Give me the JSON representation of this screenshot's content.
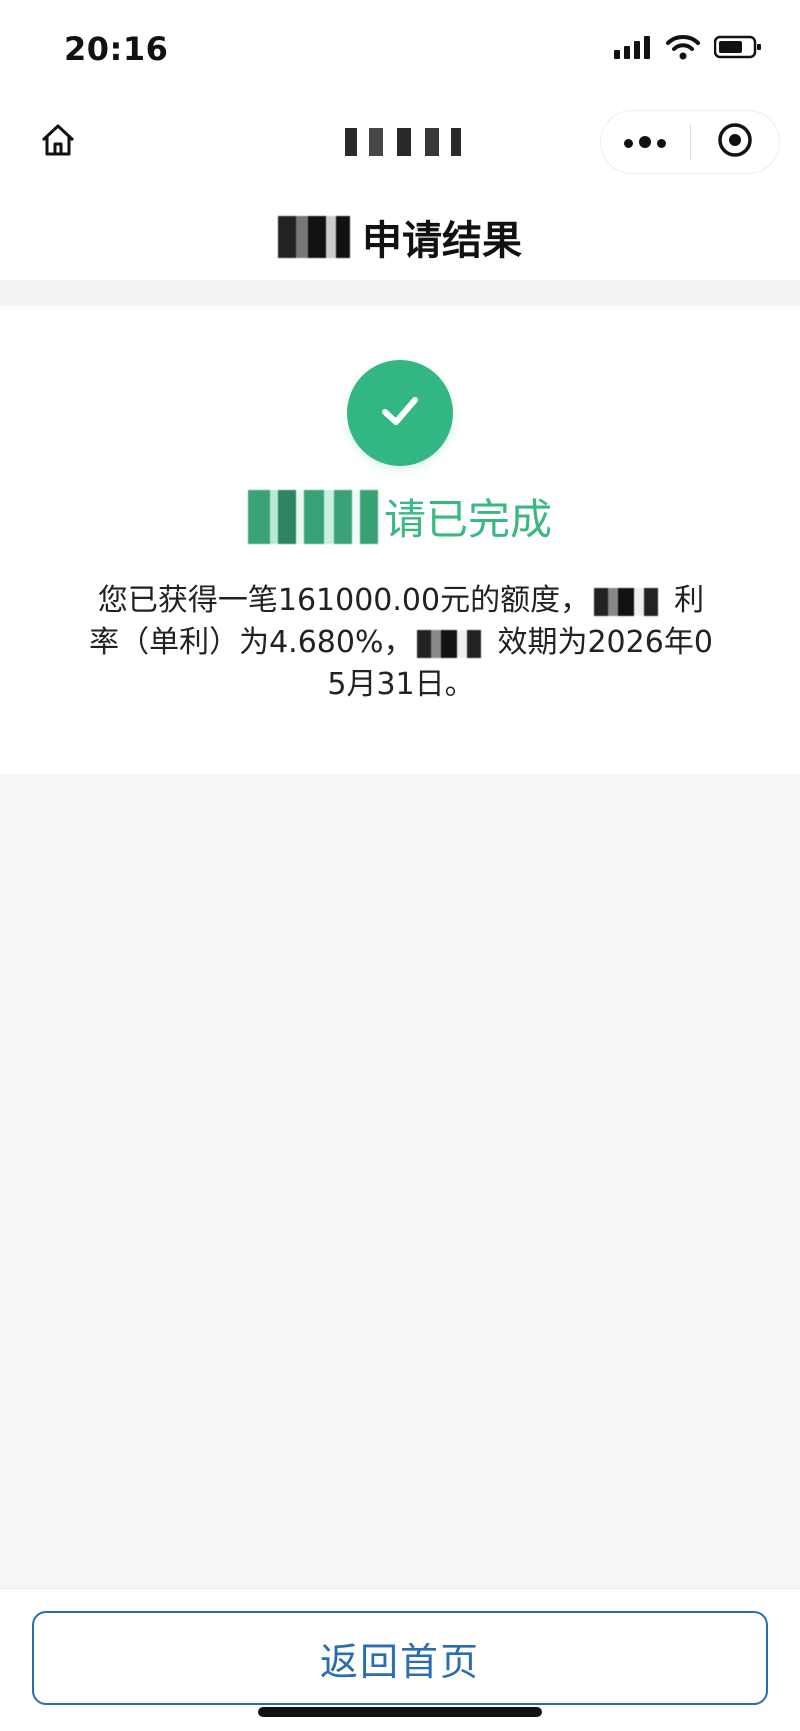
{
  "status_bar": {
    "time": "20:16"
  },
  "nav": {
    "title": ""
  },
  "page_header": {
    "title_suffix": "申请结果"
  },
  "result": {
    "title_suffix": "请已完成",
    "message_part1": "您已获得一笔161000.00元的额度，",
    "message_part2": "利率（单利）为4.680%，",
    "message_part3": "效期为2026年05月31日。"
  },
  "bottom": {
    "home_button_label": "返回首页"
  },
  "colors": {
    "success_green": "#33b782",
    "title_green": "#39b982",
    "button_blue": "#2a6db0"
  },
  "icons": {
    "home": "home-icon",
    "more": "more-dots-icon",
    "close": "close-target-icon",
    "success": "check-icon"
  }
}
